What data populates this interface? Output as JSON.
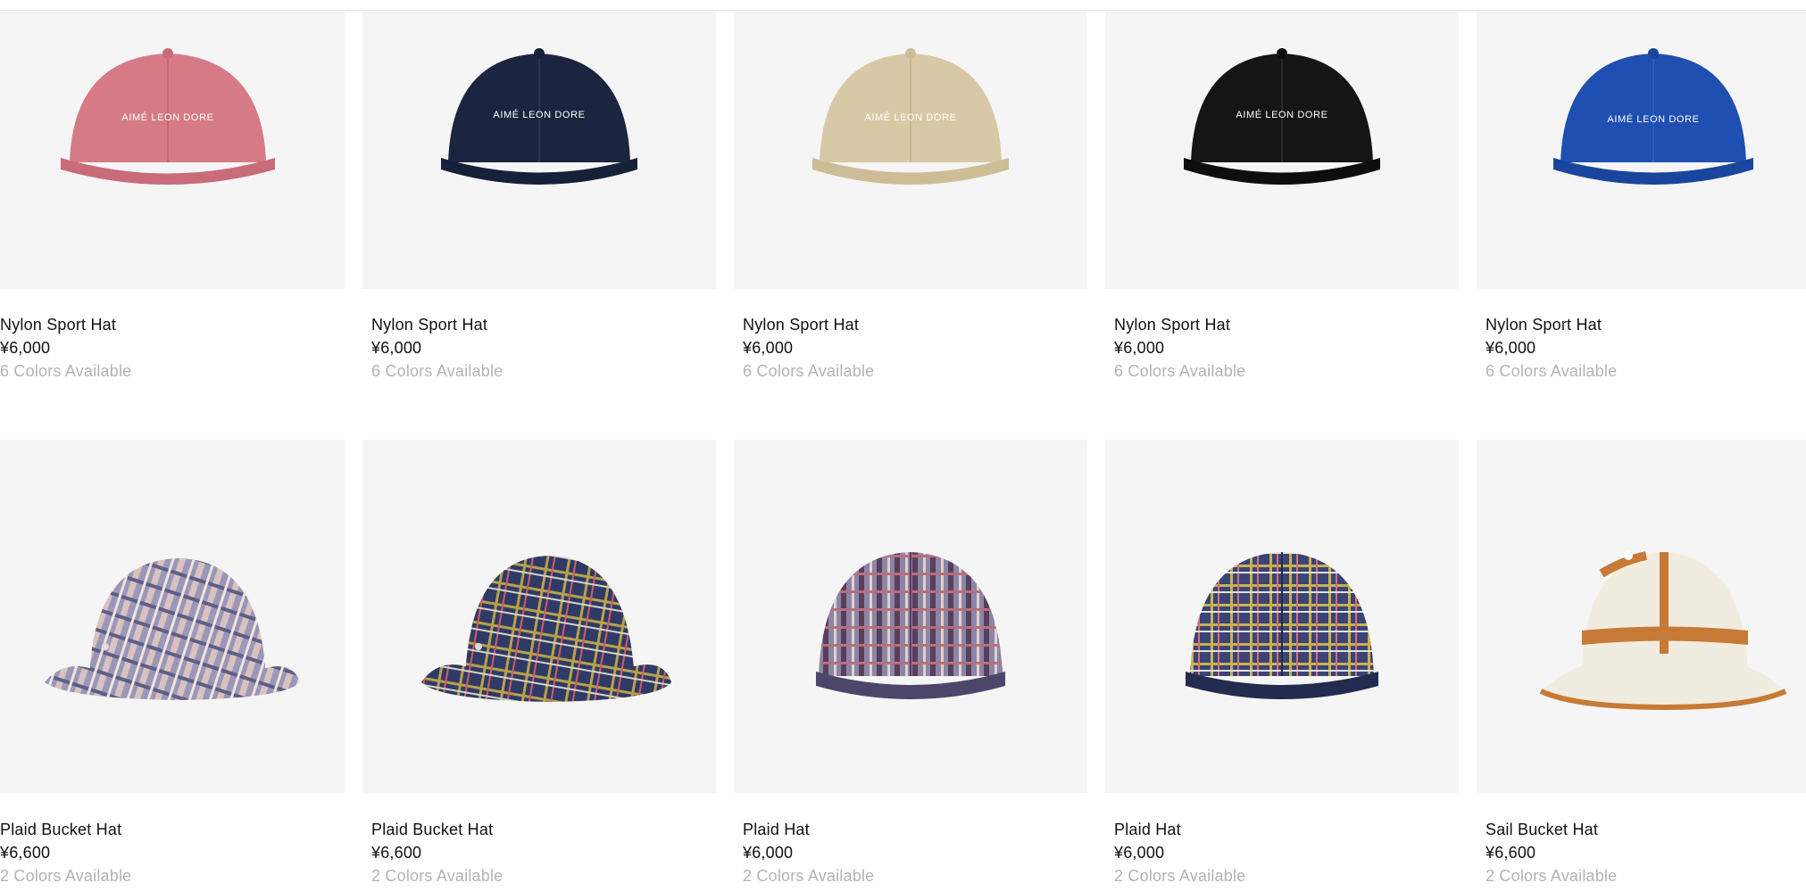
{
  "products_row_1": [
    {
      "name": "Nylon Sport Hat",
      "price": "¥6,000",
      "colors": "6 Colors Available",
      "cap_color": "#d67b86",
      "brim_color": "#c96b78",
      "logo": "AIMÉ LEON DORE",
      "style": "cap",
      "icon": "cap-icon"
    },
    {
      "name": "Nylon Sport Hat",
      "price": "¥6,000",
      "colors": "6 Colors Available",
      "cap_color": "#1c2440",
      "brim_color": "#162039",
      "logo": "AIMÉ LEON DORE",
      "style": "cap",
      "icon": "cap-icon"
    },
    {
      "name": "Nylon Sport Hat",
      "price": "¥6,000",
      "colors": "6 Colors Available",
      "cap_color": "#d8c9a6",
      "brim_color": "#cdbd97",
      "logo": "AIMÉ LEON DORE",
      "style": "cap",
      "icon": "cap-icon"
    },
    {
      "name": "Nylon Sport Hat",
      "price": "¥6,000",
      "colors": "6 Colors Available",
      "cap_color": "#151515",
      "brim_color": "#0e0e0e",
      "logo": "AIMÉ LEON DORE",
      "style": "cap",
      "icon": "cap-icon"
    },
    {
      "name": "Nylon Sport Hat",
      "price": "¥6,000",
      "colors": "6 Colors Available",
      "cap_color": "#1f4fb0",
      "brim_color": "#1a459d",
      "logo": "AIMÉ LEON DORE",
      "style": "cap",
      "icon": "cap-icon"
    }
  ],
  "products_row_2": [
    {
      "name": "Plaid Bucket Hat",
      "price": "¥6,600",
      "colors": "2 Colors Available",
      "cap_color": "#8e8fb0",
      "brim_color": "#9a95b2",
      "logo": "",
      "style": "bucket",
      "icon": "bucket-hat-icon"
    },
    {
      "name": "Plaid Bucket Hat",
      "price": "¥6,600",
      "colors": "2 Colors Available",
      "cap_color": "#2f3b66",
      "brim_color": "#2c3962",
      "logo": "",
      "style": "bucket",
      "icon": "bucket-hat-icon"
    },
    {
      "name": "Plaid Hat",
      "price": "¥6,000",
      "colors": "2 Colors Available",
      "cap_color": "#8a86a6",
      "brim_color": "#7c7a98",
      "logo": "",
      "style": "cap",
      "icon": "plaid-cap-icon"
    },
    {
      "name": "Plaid Hat",
      "price": "¥6,000",
      "colors": "2 Colors Available",
      "cap_color": "#3a4476",
      "brim_color": "#2f3a68",
      "logo": "",
      "style": "cap",
      "icon": "plaid-cap-icon"
    },
    {
      "name": "Sail Bucket Hat",
      "price": "¥6,600",
      "colors": "2 Colors Available",
      "cap_color": "#f1ece0",
      "brim_color": "#f1ece0",
      "accent": "#c77a35",
      "logo": "",
      "style": "bell",
      "icon": "bell-hat-icon"
    }
  ]
}
